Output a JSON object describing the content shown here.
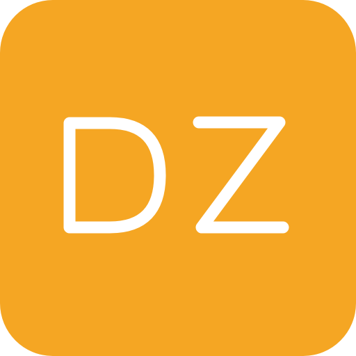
{
  "icon": {
    "name": "dz-app-icon",
    "label": "DZ",
    "background_color": "#F5A623",
    "letter_color": "#FFFFFF"
  }
}
